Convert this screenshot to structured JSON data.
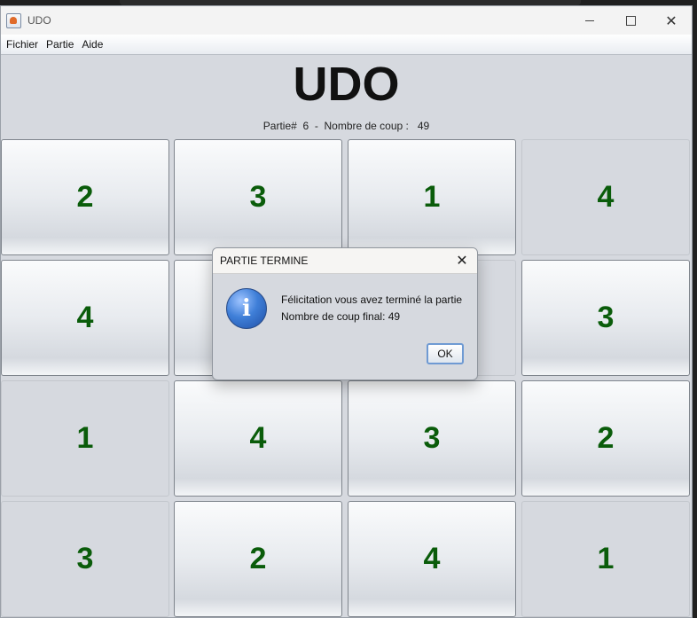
{
  "window": {
    "title": "UDO",
    "controls": {
      "minimize": "",
      "maximize": "",
      "close": "✕"
    }
  },
  "menu": [
    "Fichier",
    "Partie",
    "Aide"
  ],
  "game": {
    "title": "UDO",
    "status": "Partie#  6  -  Nombre de coup :   49",
    "grid": [
      [
        "2",
        "3",
        "1",
        "4"
      ],
      [
        "4",
        "",
        "",
        "3"
      ],
      [
        "1",
        "4",
        "3",
        "2"
      ],
      [
        "3",
        "2",
        "4",
        "1"
      ]
    ]
  },
  "dialog": {
    "title": "PARTIE TERMINE",
    "close": "✕",
    "icon": "info-icon",
    "icon_glyph": "i",
    "line1": "Félicitation vous avez terminé la partie",
    "line2": "Nombre de coup final: 49",
    "ok_label": "OK"
  }
}
